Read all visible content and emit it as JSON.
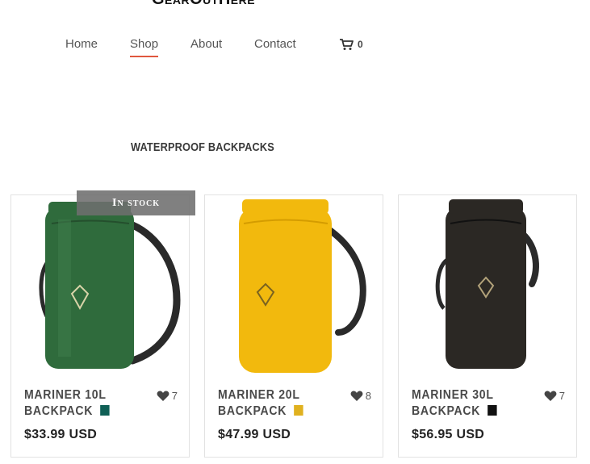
{
  "brand": {
    "logo_text": "GearOutHere"
  },
  "nav": {
    "items": [
      {
        "label": "Home"
      },
      {
        "label": "Shop",
        "active": true
      },
      {
        "label": "About"
      },
      {
        "label": "Contact"
      }
    ],
    "cart_count": "0"
  },
  "section": {
    "title": "WATERPROOF BACKPACKS"
  },
  "badge": {
    "text": "In stock"
  },
  "products": [
    {
      "name_line1": "MARINER 10L",
      "name_line2": "BACKPACK",
      "likes": "7",
      "price": "$33.99 USD",
      "swatch_color": "#0f5f55",
      "bag_color": "#2f6b3c"
    },
    {
      "name_line1": "MARINER 20L",
      "name_line2": "BACKPACK",
      "likes": "8",
      "price": "$47.99 USD",
      "swatch_color": "#e0b11f",
      "bag_color": "#f2b90d"
    },
    {
      "name_line1": "MARINER 30L",
      "name_line2": "BACKPACK",
      "likes": "7",
      "price": "$56.95 USD",
      "swatch_color": "#111111",
      "bag_color": "#2b2824"
    }
  ],
  "colors": {
    "accent": "#e0573e"
  }
}
